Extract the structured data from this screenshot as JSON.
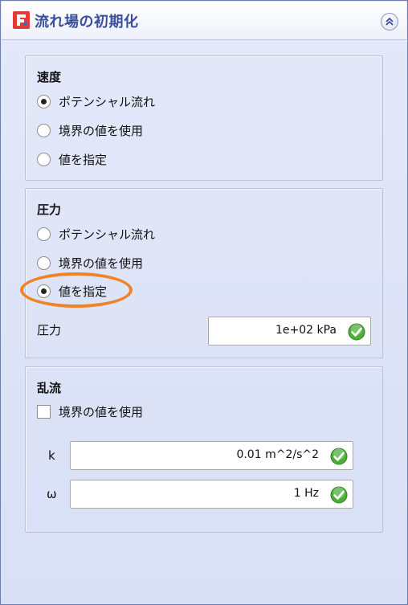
{
  "window": {
    "title": "流れ場の初期化"
  },
  "velocity": {
    "title": "速度",
    "options": [
      {
        "label": "ポテンシャル流れ",
        "selected": true
      },
      {
        "label": "境界の値を使用",
        "selected": false
      },
      {
        "label": "値を指定",
        "selected": false
      }
    ]
  },
  "pressure": {
    "title": "圧力",
    "options": [
      {
        "label": "ポテンシャル流れ",
        "selected": false
      },
      {
        "label": "境界の値を使用",
        "selected": false
      },
      {
        "label": "値を指定",
        "selected": true
      }
    ],
    "field_label": "圧力",
    "field_value": "1e+02 kPa"
  },
  "turbulence": {
    "title": "乱流",
    "checkbox_label": "境界の値を使用",
    "checkbox_checked": false,
    "k_label": "k",
    "k_value": "0.01 m^2/s^2",
    "omega_label": "ω",
    "omega_value": "1 Hz"
  },
  "colors": {
    "accent_title": "#3a4ea0",
    "highlight": "#f0832a",
    "ok_green": "#4caf3a",
    "panel_bg": "#dde3f6"
  }
}
